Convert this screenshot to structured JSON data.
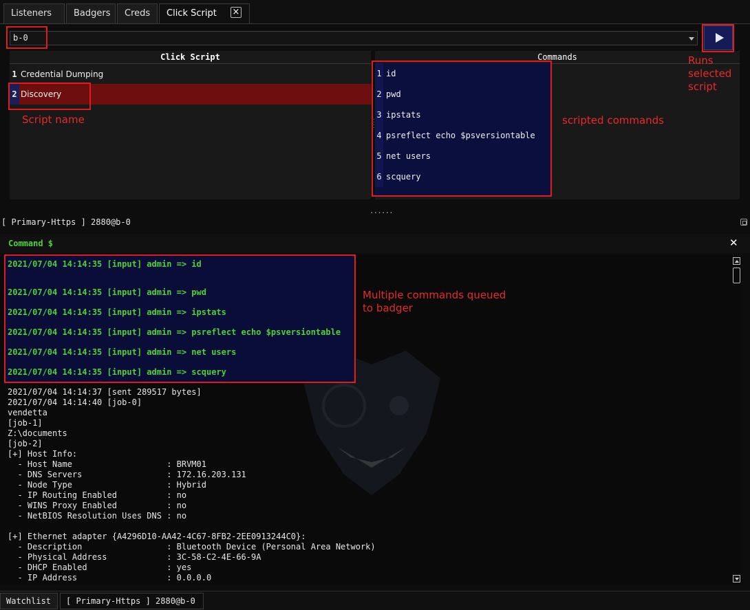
{
  "tabs": [
    {
      "label": "Listeners"
    },
    {
      "label": "Badgers"
    },
    {
      "label": "Creds"
    },
    {
      "label": "Click Script",
      "active": true
    }
  ],
  "icons": {
    "tab_close": "close-icon",
    "run": "play-icon",
    "console_close": "close-icon",
    "detach": "detach-icon"
  },
  "badger_select": {
    "value": "b-0"
  },
  "script_panel": {
    "header": "Click Script",
    "items": [
      {
        "num": "1",
        "label": "Credential Dumping",
        "selected": false
      },
      {
        "num": "2",
        "label": "Discovery",
        "selected": true
      }
    ]
  },
  "commands_panel": {
    "header": "Commands",
    "items": [
      {
        "num": "1",
        "label": "id"
      },
      {
        "num": "2",
        "label": "pwd"
      },
      {
        "num": "3",
        "label": "ipstats"
      },
      {
        "num": "4",
        "label": "psreflect echo $psversiontable"
      },
      {
        "num": "5",
        "label": "net users"
      },
      {
        "num": "6",
        "label": "scquery"
      }
    ]
  },
  "annotations": {
    "runs": "Runs\nselected\nscript",
    "script_name": "Script name",
    "scripted_commands": "scripted commands",
    "queued": "Multiple commands queued\nto badger"
  },
  "console": {
    "title": "[ Primary-Https ] 2880@b-0",
    "prompt": "Command $",
    "queued_lines": [
      "2021/07/04 14:14:35 [input] admin => id",
      "2021/07/04 14:14:35 [input] admin => pwd",
      "2021/07/04 14:14:35 [input] admin => ipstats",
      "2021/07/04 14:14:35 [input] admin => psreflect echo $psversiontable",
      "2021/07/04 14:14:35 [input] admin => net users",
      "2021/07/04 14:14:35 [input] admin => scquery"
    ],
    "output_lines": [
      "2021/07/04 14:14:37 [sent 289517 bytes]",
      "2021/07/04 14:14:40 [job-0]",
      "vendetta",
      "[job-1]",
      "Z:\\documents",
      "[job-2]",
      "[+] Host Info:",
      "  - Host Name                   : BRVM01",
      "  - DNS Servers                 : 172.16.203.131",
      "  - Node Type                   : Hybrid",
      "  - IP Routing Enabled          : no",
      "  - WINS Proxy Enabled          : no",
      "  - NetBIOS Resolution Uses DNS : no",
      "",
      "[+] Ethernet adapter {A4296D10-AA42-4C67-8FB2-2EE0913244C0}:",
      "  - Description                 : Bluetooth Device (Personal Area Network)",
      "  - Physical Address            : 3C-58-C2-4E-66-9A",
      "  - DHCP Enabled                : yes",
      "  - IP Address                  : 0.0.0.0"
    ]
  },
  "bottom_tabs": [
    {
      "label": "Watchlist"
    },
    {
      "label": "[ Primary-Https ] 2880@b-0",
      "active": true
    }
  ],
  "colors": {
    "selected_row": "#6e0f0f",
    "command_list_bg": "#0b0f3e",
    "run_button": "#141b56",
    "prompt_green": "#4cd13a",
    "annotation_red": "#e01c1c"
  }
}
